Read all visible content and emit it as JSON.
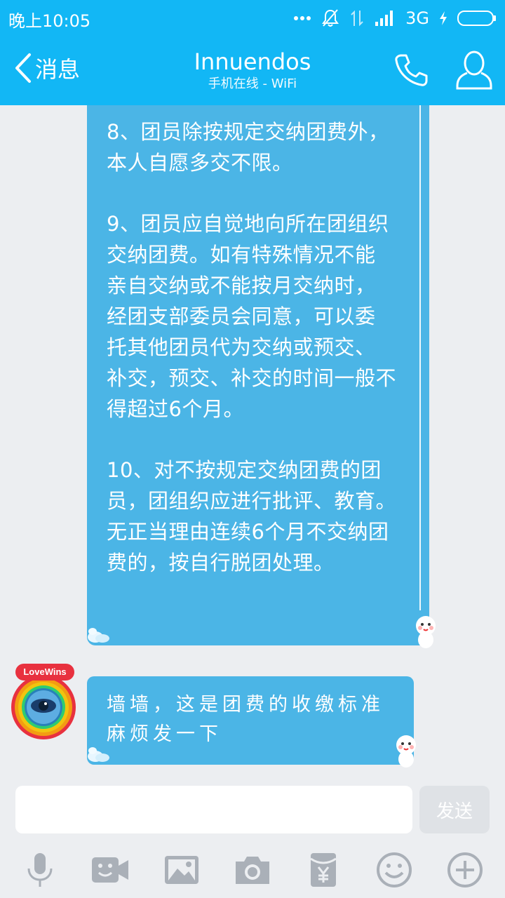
{
  "status": {
    "time": "晚上10:05",
    "network": "3G"
  },
  "header": {
    "back_label": "消息",
    "title": "Innuendos",
    "subtitle": "手机在线 - WiFi"
  },
  "messages": [
    {
      "paragraphs": [
        "8、团员除按规定交纳团费外，\n本人自愿多交不限。",
        "9、团员应自觉地向所在团组织\n交纳团费。如有特殊情况不能\n亲自交纳或不能按月交纳时，\n经团支部委员会同意，可以委\n托其他团员代为交纳或预交、\n补交，预交、补交的时间一般不\n得超过6个月。",
        "10、对不按规定交纳团费的团\n员，团组织应进行批评、教育。\n无正当理由连续6个月不交纳团\n费的，按自行脱团处理。"
      ]
    },
    {
      "text": "墙墙，这是团费的收缴标准麻烦发一下"
    }
  ],
  "avatar": {
    "badge": "LoveWins"
  },
  "input": {
    "value": "",
    "send_label": "发送"
  },
  "colors": {
    "header": "#12b7f5",
    "bubble": "#4bb5e6",
    "background": "#eceef1"
  },
  "toolbar_icons": [
    "microphone-icon",
    "video-icon",
    "image-icon",
    "camera-icon",
    "red-packet-icon",
    "emoji-icon",
    "plus-icon"
  ]
}
